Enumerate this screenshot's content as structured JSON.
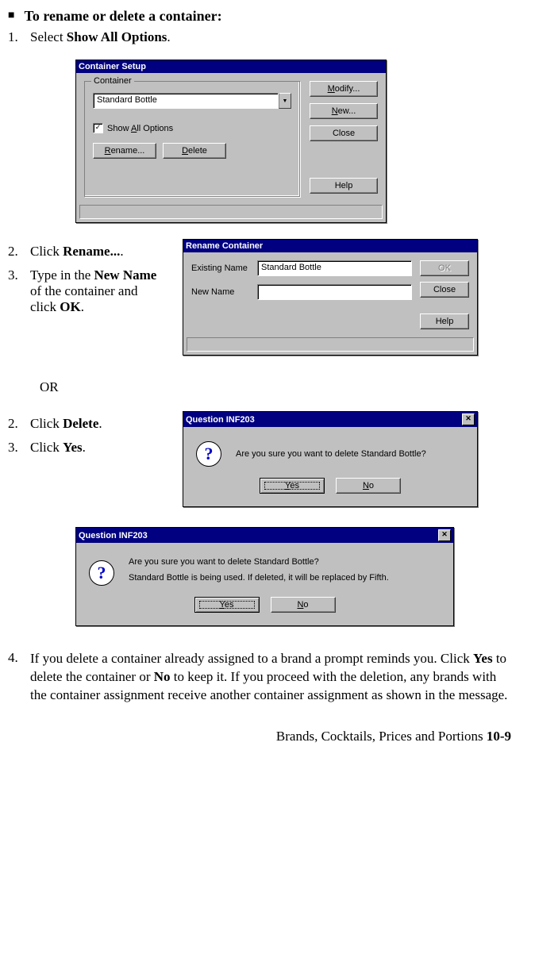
{
  "heading": "To rename or delete a container:",
  "steps_a": {
    "s1": {
      "num": "1.",
      "pre": "Select ",
      "bold": "Show All Options",
      "post": "."
    },
    "s2": {
      "num": "2.",
      "pre": "Click ",
      "bold": "Rename...",
      "post": "."
    },
    "s3": {
      "num": "3.",
      "t1": "Type in the ",
      "b1": "New Name",
      "t2": " of the container and click ",
      "b2": "OK",
      "t3": "."
    }
  },
  "or_label": "OR",
  "steps_b": {
    "s2": {
      "num": "2.",
      "pre": "Click ",
      "bold": "Delete",
      "post": "."
    },
    "s3": {
      "num": "3.",
      "pre": "Click ",
      "bold": "Yes",
      "post": "."
    },
    "s4": {
      "num": "4.",
      "t1": "If you delete a container already assigned to a brand a prompt reminds you. Click ",
      "b1": "Yes",
      "t2": " to delete the container or ",
      "b2": "No",
      "t3": " to keep it. If you proceed with the deletion, any brands with the container assignment receive another container assignment as shown in the message."
    }
  },
  "dlg_container_setup": {
    "title": "Container Setup",
    "group_label": "Container",
    "dropdown_value": "Standard Bottle",
    "checkbox_label_pre": "Show ",
    "checkbox_u": "A",
    "checkbox_label_post": "ll Options",
    "btn_rename_u": "R",
    "btn_rename_rest": "ename...",
    "btn_delete_u": "D",
    "btn_delete_rest": "elete",
    "btn_modify_u": "M",
    "btn_modify_rest": "odify...",
    "btn_new_u": "N",
    "btn_new_rest": "ew...",
    "btn_close": "Close",
    "btn_help": "Help"
  },
  "dlg_rename": {
    "title": "Rename Container",
    "lbl_existing": "Existing Name",
    "val_existing": "Standard Bottle",
    "lbl_new": "New Name",
    "btn_ok": "OK",
    "btn_close": "Close",
    "btn_help": "Help"
  },
  "dlg_q1": {
    "title": "Question INF203",
    "msg": "Are you sure you want to delete Standard Bottle?",
    "yes_u": "Y",
    "yes_rest": "es",
    "no_u": "N",
    "no_rest": "o"
  },
  "dlg_q2": {
    "title": "Question INF203",
    "msg1": "Are you sure you want to delete Standard Bottle?",
    "msg2": "Standard Bottle is being used. If deleted, it will be replaced by Fifth.",
    "yes_u": "Y",
    "yes_rest": "es",
    "no_u": "N",
    "no_rest": "o"
  },
  "footer": {
    "text": "Brands, Cocktails, Prices and Portions  ",
    "page": "10-9"
  }
}
